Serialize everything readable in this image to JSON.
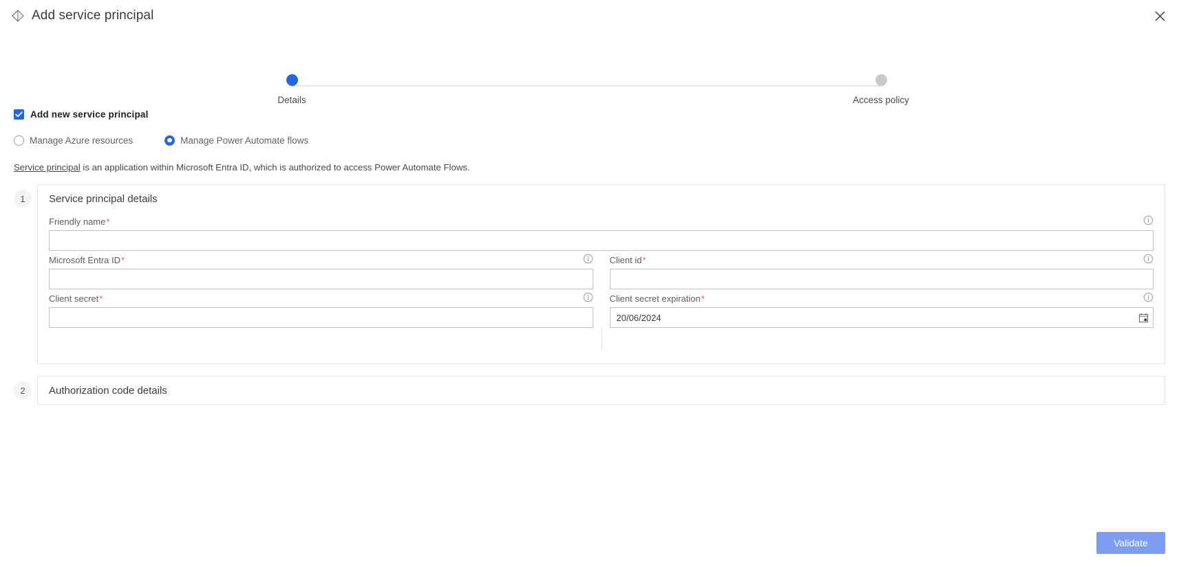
{
  "window": {
    "title": "Add service principal",
    "title_icon": "diamond-outline-icon",
    "close_label": "✕"
  },
  "stepper": {
    "steps": [
      {
        "label": "Details",
        "state": "active"
      },
      {
        "label": "Access policy",
        "state": "inactive"
      }
    ],
    "active_color": "#2266e3",
    "inactive_color": "#c9c9c9"
  },
  "options": {
    "checkbox": {
      "label": "Add new service principal",
      "checked": true
    },
    "radios": [
      {
        "label": "Manage Azure resources",
        "selected": false
      },
      {
        "label": "Manage Power Automate flows",
        "selected": true
      }
    ]
  },
  "description": {
    "link_text": "Service principal",
    "rest_text": " is an application within Microsoft Entra ID, which is authorized to access Power Automate Flows."
  },
  "sections": [
    {
      "number": "1",
      "title": "Service principal details",
      "expanded": true
    },
    {
      "number": "2",
      "title": "Authorization code details",
      "expanded": false
    }
  ],
  "form": {
    "friendly_name": {
      "label": "Friendly name",
      "required": "*",
      "value": "",
      "placeholder": "",
      "info": "info-icon"
    },
    "entra_id": {
      "label": "Microsoft Entra ID",
      "required": "*",
      "value": "",
      "placeholder": "",
      "info": "info-icon"
    },
    "client_id": {
      "label": "Client id",
      "required": "*",
      "value": "",
      "placeholder": "",
      "info": "info-icon"
    },
    "client_secret": {
      "label": "Client secret",
      "required": "*",
      "value": "",
      "placeholder": "",
      "info": "info-icon"
    },
    "client_secret_expiration": {
      "label": "Client secret expiration",
      "required": "*",
      "value": "20/06/2024",
      "placeholder": "",
      "info": "info-icon",
      "calendar_icon": "calendar-icon"
    }
  },
  "footer": {
    "validate_label": "Validate",
    "validate_color": "#7c9df0"
  }
}
